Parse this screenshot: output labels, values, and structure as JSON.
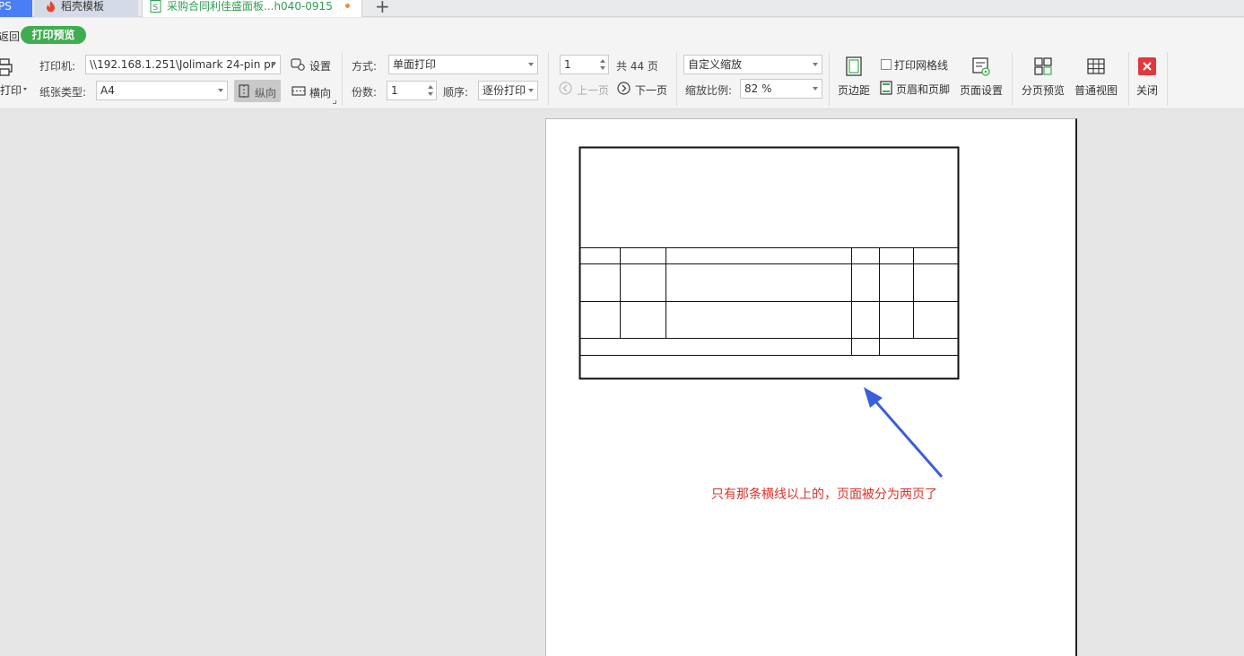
{
  "tabs": {
    "wps": "PS",
    "template": "稻壳模板",
    "document": "采购合同利佳盛面板...h040-0915",
    "add": "+"
  },
  "mode": {
    "back_label": "返回",
    "preview_label": "打印预览"
  },
  "printer": {
    "print_label": "打印",
    "printer_label": "打印机:",
    "printer_value": "\\\\192.168.1.251\\Jolimark 24-pin pr",
    "settings_label": "设置",
    "paper_label": "纸张类型:",
    "paper_value": "A4",
    "portrait_label": "纵向",
    "landscape_label": "横向"
  },
  "copies": {
    "method_label": "方式:",
    "method_value": "单面打印",
    "count_label": "份数:",
    "count_value": "1",
    "order_label": "顺序:",
    "order_value": "逐份打印"
  },
  "paging": {
    "current_page": "1",
    "total_label": "共 44 页",
    "prev_label": "上一页",
    "next_label": "下一页"
  },
  "zoom": {
    "mode_value": "自定义缩放",
    "ratio_label": "缩放比例:",
    "ratio_value": "82 %"
  },
  "toolbar": {
    "margins_label": "页边距",
    "gridlines_label": "打印网格线",
    "header_footer_label": "页眉和页脚",
    "page_setup_label": "页面设置",
    "page_break_preview_label": "分页预览",
    "normal_view_label": "普通视图",
    "close_label": "关闭"
  },
  "annotation": {
    "text": "只有那条横线以上的，页面被分为两页了"
  },
  "colors": {
    "accent_green": "#3fad4e",
    "tab_doc_text": "#2f9f4f",
    "annotation_red": "#d9342b",
    "arrow_blue": "#3a5fd8",
    "close_red": "#e0393c"
  }
}
